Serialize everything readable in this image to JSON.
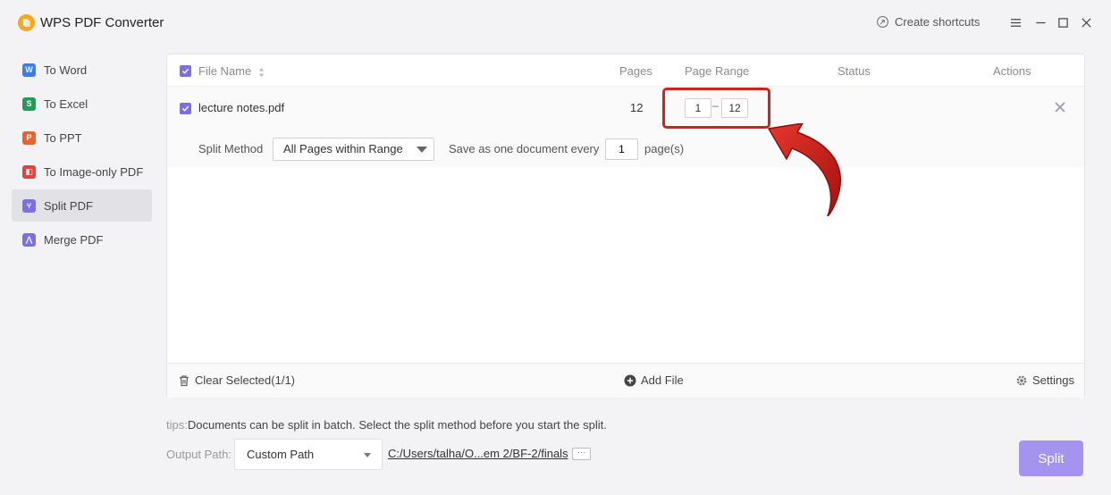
{
  "app": {
    "title": "WPS PDF Converter",
    "create_shortcuts": "Create shortcuts",
    "logo_color": "#f5a623"
  },
  "sidebar": {
    "items": [
      {
        "label": "To Word",
        "icon": "word-icon",
        "color": "#3b7cf5",
        "glyph": "W"
      },
      {
        "label": "To Excel",
        "icon": "excel-icon",
        "color": "#1f9e5a",
        "glyph": "S"
      },
      {
        "label": "To PPT",
        "icon": "ppt-icon",
        "color": "#f0602b",
        "glyph": "P"
      },
      {
        "label": "To Image-only PDF",
        "icon": "image-pdf-icon",
        "color": "#e8413c",
        "glyph": "◧"
      },
      {
        "label": "Split PDF",
        "icon": "split-pdf-icon",
        "color": "#7b6fe6",
        "glyph": "⑂",
        "active": true
      },
      {
        "label": "Merge PDF",
        "icon": "merge-pdf-icon",
        "color": "#7b6fe6",
        "glyph": "⋀"
      }
    ]
  },
  "table": {
    "headers": {
      "file_name": "File Name",
      "pages": "Pages",
      "page_range": "Page Range",
      "status": "Status",
      "actions": "Actions"
    },
    "rows": [
      {
        "file_name": "lecture notes.pdf",
        "pages": "12",
        "range_from": "1",
        "range_to": "12",
        "status": "",
        "checked": true
      }
    ],
    "split": {
      "method_label": "Split Method",
      "method_value": "All Pages within Range",
      "every_label": "Save as one document every",
      "every_value": "1",
      "unit": "page(s)"
    },
    "footer": {
      "clear_selected": "Clear Selected(1/1)",
      "add_file": "Add File",
      "settings": "Settings"
    }
  },
  "bottom": {
    "tips_prefix": "tips:",
    "tips_text": "Documents can be split in batch. Select the split method before you start the split.",
    "output_label": "Output Path:",
    "output_option": "Custom Path",
    "output_path": "C:/Users/talha/O...em 2/BF-2/finals",
    "more": "···",
    "split_button": "Split"
  },
  "colors": {
    "accent": "#7b6fe6",
    "split_button": "#a493ef",
    "highlight": "#d4201f"
  }
}
